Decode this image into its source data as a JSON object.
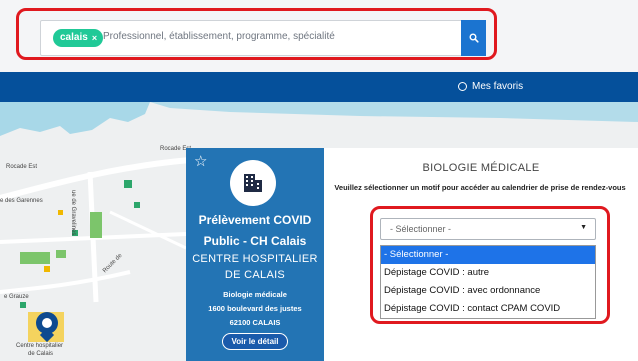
{
  "search": {
    "chip_label": "calais",
    "chip_close": "×",
    "placeholder": "Professionnel, établissement, programme, spécialité",
    "button_icon": "search-icon"
  },
  "nav": {
    "favorites_label": "Mes favoris"
  },
  "map": {
    "labels": {
      "rocade_est_1": "Rocade Est",
      "rocade_est_2": "Rocade Est",
      "des_garennes": "e des Garennes",
      "gravelines": "ue de Gravelines",
      "grauze": "e Grauze",
      "route_de": "Route de",
      "hospital_1": "Centre hospitalier",
      "hospital_2": "de Calais"
    }
  },
  "card": {
    "title": "Prélèvement COVID",
    "subtitle": "Public - CH Calais",
    "name": "CENTRE HOSPITALIER DE CALAIS",
    "specialty": "Biologie médicale",
    "address": "1600 boulevard des justes",
    "city": "62100 CALAIS",
    "detail_button": "Voir le détail"
  },
  "panel": {
    "title": "BIOLOGIE MÉDICALE",
    "instruction": "Veuillez sélectionner un motif pour accéder au calendrier de prise de rendez-vous",
    "select_value": "- Sélectionner -",
    "options": [
      "- Sélectionner -",
      "Dépistage COVID : autre",
      "Dépistage COVID : avec ordonnance",
      "Dépistage COVID : contact CPAM COVID"
    ]
  },
  "colors": {
    "accent": "#1b74d0",
    "nav": "#05509b",
    "card": "#2374b4",
    "chip": "#20c997",
    "highlight": "#e0191f",
    "selected_option": "#1e73e8"
  }
}
